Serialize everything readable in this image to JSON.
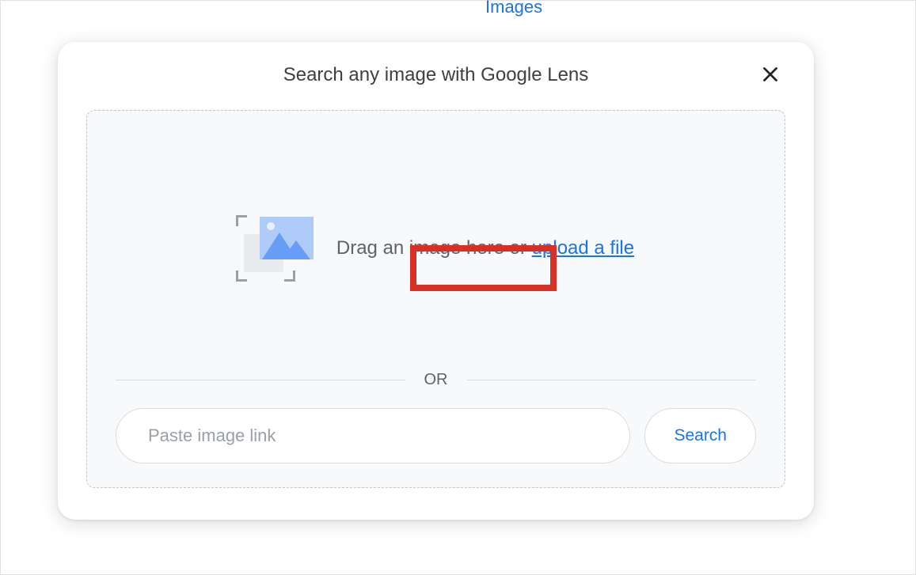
{
  "background": {
    "images_link": "Images"
  },
  "dialog": {
    "title": "Search any image with Google Lens",
    "drag_text_prefix": "Drag an image here or ",
    "upload_link": "upload a file",
    "or_label": "OR",
    "url_placeholder": "Paste image link",
    "search_button": "Search"
  },
  "annotations": {
    "highlight_target": "upload-link"
  }
}
